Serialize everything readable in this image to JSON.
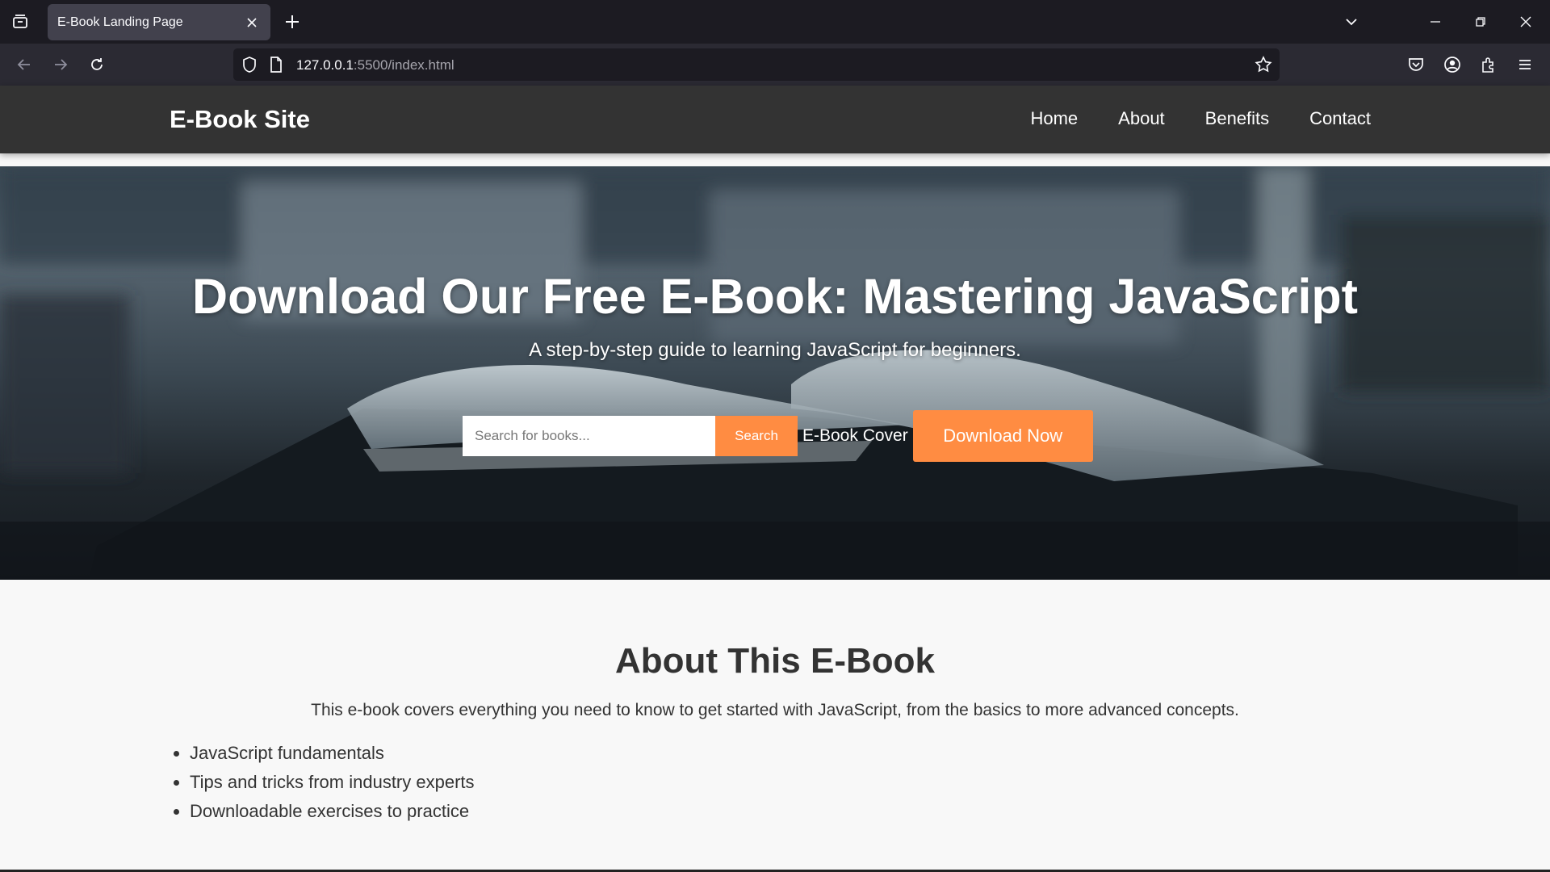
{
  "browser": {
    "tab_title": "E-Book Landing Page",
    "url_host": "127.0.0.1",
    "url_rest": ":5500/index.html"
  },
  "site": {
    "brand": "E-Book Site",
    "nav": [
      "Home",
      "About",
      "Benefits",
      "Contact"
    ]
  },
  "hero": {
    "title": "Download Our Free E-Book: Mastering JavaScript",
    "subtitle": "A step-by-step guide to learning JavaScript for beginners.",
    "search_placeholder": "Search for books...",
    "search_button": "Search",
    "cover_alt": "E-Book Cover",
    "download_button": "Download Now"
  },
  "about": {
    "heading": "About This E-Book",
    "description": "This e-book covers everything you need to know to get started with JavaScript, from the basics to more advanced concepts.",
    "items": [
      "JavaScript fundamentals",
      "Tips and tricks from industry experts",
      "Downloadable exercises to practice"
    ]
  },
  "colors": {
    "accent": "#ff8c42",
    "header_bg": "#333333"
  }
}
